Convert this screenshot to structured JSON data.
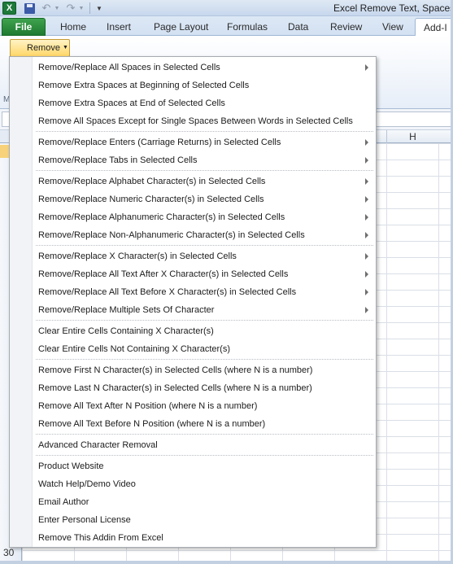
{
  "window": {
    "title": "Excel Remove Text, Spaces"
  },
  "quick_access": {
    "logo_letter": "X",
    "icons": [
      "excel-logo-icon",
      "save-icon",
      "undo-icon",
      "redo-icon",
      "customize-arrow-icon"
    ]
  },
  "ribbon": {
    "file_tab": "File",
    "tabs": [
      "Home",
      "Insert",
      "Page Layout",
      "Formulas",
      "Data",
      "Review",
      "View"
    ],
    "active_tab": "Add-I",
    "remove_button": "Remove",
    "group_letter": "M"
  },
  "grid": {
    "visible_column_letter": "H",
    "bottom_row_number": "30"
  },
  "colors": {
    "file_tab": "#1e7a30",
    "remove_button": "#ffd768",
    "menu_border": "#a7abb0",
    "active_row": "#f7d27a"
  },
  "menu": {
    "groups": [
      {
        "items": [
          {
            "label": "Remove/Replace All Spaces in Selected Cells",
            "submenu": true
          },
          {
            "label": "Remove Extra Spaces at Beginning of Selected Cells",
            "submenu": false
          },
          {
            "label": "Remove Extra Spaces at End of Selected Cells",
            "submenu": false
          },
          {
            "label": "Remove All Spaces Except for Single Spaces Between Words in Selected Cells",
            "submenu": false
          }
        ]
      },
      {
        "items": [
          {
            "label": "Remove/Replace Enters (Carriage Returns) in Selected Cells",
            "submenu": true
          },
          {
            "label": "Remove/Replace Tabs in Selected Cells",
            "submenu": true
          }
        ]
      },
      {
        "items": [
          {
            "label": "Remove/Replace Alphabet Character(s) in Selected Cells",
            "submenu": true
          },
          {
            "label": "Remove/Replace Numeric Character(s) in Selected Cells",
            "submenu": true
          },
          {
            "label": "Remove/Replace Alphanumeric Character(s) in Selected Cells",
            "submenu": true
          },
          {
            "label": "Remove/Replace Non-Alphanumeric Character(s) in Selected Cells",
            "submenu": true
          }
        ]
      },
      {
        "items": [
          {
            "label": "Remove/Replace X Character(s) in Selected Cells",
            "submenu": true
          },
          {
            "label": "Remove/Replace All Text After X Character(s) in Selected Cells",
            "submenu": true
          },
          {
            "label": "Remove/Replace All Text Before X Character(s) in Selected Cells",
            "submenu": true
          },
          {
            "label": "Remove/Replace Multiple Sets Of Character",
            "submenu": true
          }
        ]
      },
      {
        "items": [
          {
            "label": "Clear Entire Cells Containing X Character(s)",
            "submenu": false
          },
          {
            "label": "Clear Entire Cells Not Containing X Character(s)",
            "submenu": false
          }
        ]
      },
      {
        "items": [
          {
            "label": "Remove First N Character(s) in Selected Cells (where N is a number)",
            "submenu": false
          },
          {
            "label": "Remove Last N Character(s) in Selected Cells (where N is a number)",
            "submenu": false
          },
          {
            "label": "Remove All Text After N Position (where N is a number)",
            "submenu": false
          },
          {
            "label": "Remove All Text Before N Position (where N is a number)",
            "submenu": false
          }
        ]
      },
      {
        "items": [
          {
            "label": "Advanced Character Removal",
            "submenu": false
          }
        ]
      },
      {
        "items": [
          {
            "label": "Product Website",
            "submenu": false
          },
          {
            "label": "Watch Help/Demo Video",
            "submenu": false
          },
          {
            "label": "Email Author",
            "submenu": false
          },
          {
            "label": "Enter Personal License",
            "submenu": false
          },
          {
            "label": "Remove This Addin From Excel",
            "submenu": false
          }
        ]
      }
    ]
  }
}
